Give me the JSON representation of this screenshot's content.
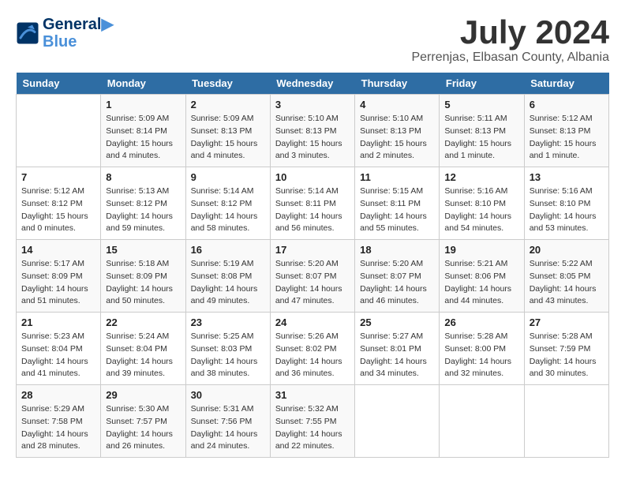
{
  "header": {
    "logo_line1": "General",
    "logo_line2": "Blue",
    "month_title": "July 2024",
    "subtitle": "Perrenjas, Elbasan County, Albania"
  },
  "weekdays": [
    "Sunday",
    "Monday",
    "Tuesday",
    "Wednesday",
    "Thursday",
    "Friday",
    "Saturday"
  ],
  "weeks": [
    [
      {
        "day": "",
        "info": ""
      },
      {
        "day": "1",
        "info": "Sunrise: 5:09 AM\nSunset: 8:14 PM\nDaylight: 15 hours\nand 4 minutes."
      },
      {
        "day": "2",
        "info": "Sunrise: 5:09 AM\nSunset: 8:13 PM\nDaylight: 15 hours\nand 4 minutes."
      },
      {
        "day": "3",
        "info": "Sunrise: 5:10 AM\nSunset: 8:13 PM\nDaylight: 15 hours\nand 3 minutes."
      },
      {
        "day": "4",
        "info": "Sunrise: 5:10 AM\nSunset: 8:13 PM\nDaylight: 15 hours\nand 2 minutes."
      },
      {
        "day": "5",
        "info": "Sunrise: 5:11 AM\nSunset: 8:13 PM\nDaylight: 15 hours\nand 1 minute."
      },
      {
        "day": "6",
        "info": "Sunrise: 5:12 AM\nSunset: 8:13 PM\nDaylight: 15 hours\nand 1 minute."
      }
    ],
    [
      {
        "day": "7",
        "info": "Sunrise: 5:12 AM\nSunset: 8:12 PM\nDaylight: 15 hours\nand 0 minutes."
      },
      {
        "day": "8",
        "info": "Sunrise: 5:13 AM\nSunset: 8:12 PM\nDaylight: 14 hours\nand 59 minutes."
      },
      {
        "day": "9",
        "info": "Sunrise: 5:14 AM\nSunset: 8:12 PM\nDaylight: 14 hours\nand 58 minutes."
      },
      {
        "day": "10",
        "info": "Sunrise: 5:14 AM\nSunset: 8:11 PM\nDaylight: 14 hours\nand 56 minutes."
      },
      {
        "day": "11",
        "info": "Sunrise: 5:15 AM\nSunset: 8:11 PM\nDaylight: 14 hours\nand 55 minutes."
      },
      {
        "day": "12",
        "info": "Sunrise: 5:16 AM\nSunset: 8:10 PM\nDaylight: 14 hours\nand 54 minutes."
      },
      {
        "day": "13",
        "info": "Sunrise: 5:16 AM\nSunset: 8:10 PM\nDaylight: 14 hours\nand 53 minutes."
      }
    ],
    [
      {
        "day": "14",
        "info": "Sunrise: 5:17 AM\nSunset: 8:09 PM\nDaylight: 14 hours\nand 51 minutes."
      },
      {
        "day": "15",
        "info": "Sunrise: 5:18 AM\nSunset: 8:09 PM\nDaylight: 14 hours\nand 50 minutes."
      },
      {
        "day": "16",
        "info": "Sunrise: 5:19 AM\nSunset: 8:08 PM\nDaylight: 14 hours\nand 49 minutes."
      },
      {
        "day": "17",
        "info": "Sunrise: 5:20 AM\nSunset: 8:07 PM\nDaylight: 14 hours\nand 47 minutes."
      },
      {
        "day": "18",
        "info": "Sunrise: 5:20 AM\nSunset: 8:07 PM\nDaylight: 14 hours\nand 46 minutes."
      },
      {
        "day": "19",
        "info": "Sunrise: 5:21 AM\nSunset: 8:06 PM\nDaylight: 14 hours\nand 44 minutes."
      },
      {
        "day": "20",
        "info": "Sunrise: 5:22 AM\nSunset: 8:05 PM\nDaylight: 14 hours\nand 43 minutes."
      }
    ],
    [
      {
        "day": "21",
        "info": "Sunrise: 5:23 AM\nSunset: 8:04 PM\nDaylight: 14 hours\nand 41 minutes."
      },
      {
        "day": "22",
        "info": "Sunrise: 5:24 AM\nSunset: 8:04 PM\nDaylight: 14 hours\nand 39 minutes."
      },
      {
        "day": "23",
        "info": "Sunrise: 5:25 AM\nSunset: 8:03 PM\nDaylight: 14 hours\nand 38 minutes."
      },
      {
        "day": "24",
        "info": "Sunrise: 5:26 AM\nSunset: 8:02 PM\nDaylight: 14 hours\nand 36 minutes."
      },
      {
        "day": "25",
        "info": "Sunrise: 5:27 AM\nSunset: 8:01 PM\nDaylight: 14 hours\nand 34 minutes."
      },
      {
        "day": "26",
        "info": "Sunrise: 5:28 AM\nSunset: 8:00 PM\nDaylight: 14 hours\nand 32 minutes."
      },
      {
        "day": "27",
        "info": "Sunrise: 5:28 AM\nSunset: 7:59 PM\nDaylight: 14 hours\nand 30 minutes."
      }
    ],
    [
      {
        "day": "28",
        "info": "Sunrise: 5:29 AM\nSunset: 7:58 PM\nDaylight: 14 hours\nand 28 minutes."
      },
      {
        "day": "29",
        "info": "Sunrise: 5:30 AM\nSunset: 7:57 PM\nDaylight: 14 hours\nand 26 minutes."
      },
      {
        "day": "30",
        "info": "Sunrise: 5:31 AM\nSunset: 7:56 PM\nDaylight: 14 hours\nand 24 minutes."
      },
      {
        "day": "31",
        "info": "Sunrise: 5:32 AM\nSunset: 7:55 PM\nDaylight: 14 hours\nand 22 minutes."
      },
      {
        "day": "",
        "info": ""
      },
      {
        "day": "",
        "info": ""
      },
      {
        "day": "",
        "info": ""
      }
    ]
  ]
}
